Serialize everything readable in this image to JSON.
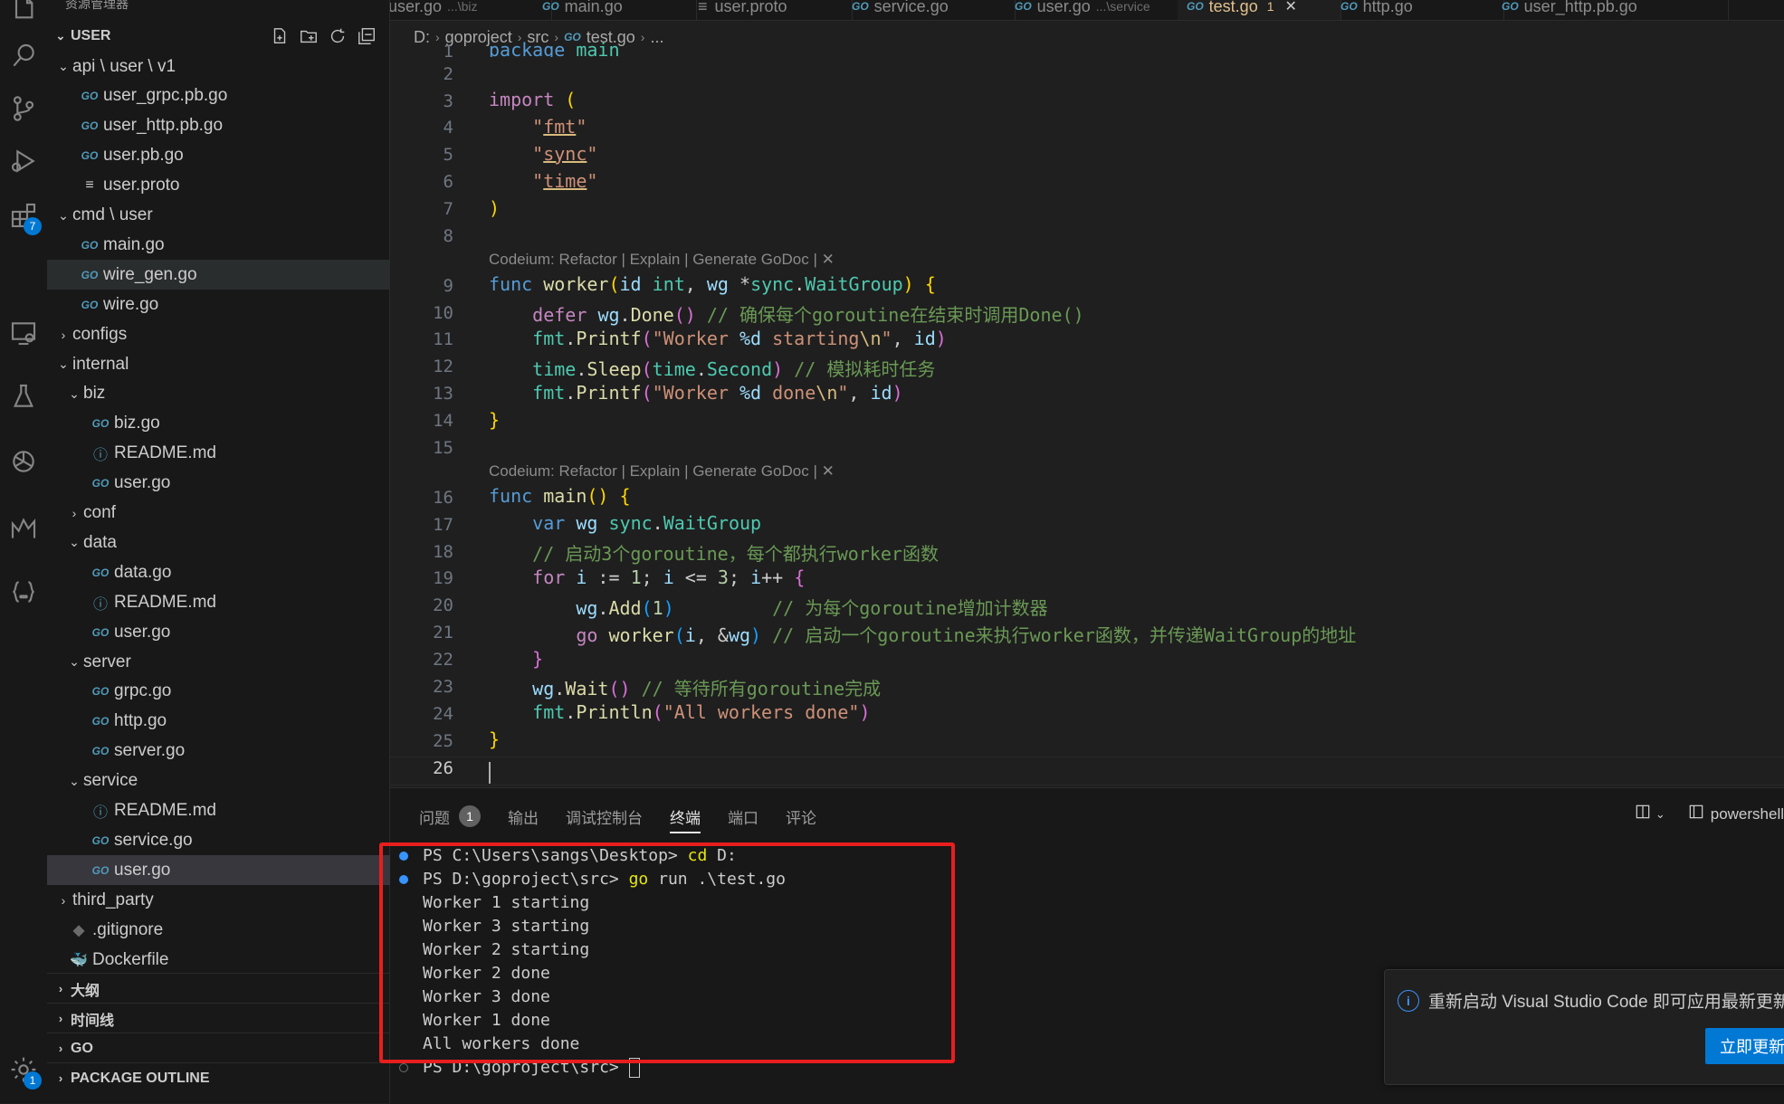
{
  "sidebar": {
    "title": "资源管理器",
    "section_user": "USER",
    "tree": [
      {
        "label": "api \\ user \\ v1",
        "type": "folder-open",
        "indent": 1
      },
      {
        "label": "user_grpc.pb.go",
        "type": "go",
        "indent": 2
      },
      {
        "label": "user_http.pb.go",
        "type": "go",
        "indent": 2
      },
      {
        "label": "user.pb.go",
        "type": "go",
        "indent": 2
      },
      {
        "label": "user.proto",
        "type": "proto",
        "indent": 2
      },
      {
        "label": "cmd \\ user",
        "type": "folder-open",
        "indent": 1
      },
      {
        "label": "main.go",
        "type": "go",
        "indent": 2
      },
      {
        "label": "wire_gen.go",
        "type": "go",
        "indent": 2
      },
      {
        "label": "wire.go",
        "type": "go",
        "indent": 2
      },
      {
        "label": "configs",
        "type": "folder-closed",
        "indent": 1
      },
      {
        "label": "internal",
        "type": "folder-open",
        "indent": 1
      },
      {
        "label": "biz",
        "type": "folder-open",
        "indent": 2
      },
      {
        "label": "biz.go",
        "type": "go",
        "indent": 3
      },
      {
        "label": "README.md",
        "type": "info",
        "indent": 3
      },
      {
        "label": "user.go",
        "type": "go",
        "indent": 3
      },
      {
        "label": "conf",
        "type": "folder-closed",
        "indent": 2
      },
      {
        "label": "data",
        "type": "folder-open",
        "indent": 2
      },
      {
        "label": "data.go",
        "type": "go",
        "indent": 3
      },
      {
        "label": "README.md",
        "type": "info",
        "indent": 3
      },
      {
        "label": "user.go",
        "type": "go",
        "indent": 3
      },
      {
        "label": "server",
        "type": "folder-open",
        "indent": 2
      },
      {
        "label": "grpc.go",
        "type": "go",
        "indent": 3
      },
      {
        "label": "http.go",
        "type": "go",
        "indent": 3
      },
      {
        "label": "server.go",
        "type": "go",
        "indent": 3
      },
      {
        "label": "service",
        "type": "folder-open",
        "indent": 2
      },
      {
        "label": "README.md",
        "type": "info",
        "indent": 3
      },
      {
        "label": "service.go",
        "type": "go",
        "indent": 3
      },
      {
        "label": "user.go",
        "type": "go",
        "indent": 3
      },
      {
        "label": "third_party",
        "type": "folder-closed",
        "indent": 1
      },
      {
        "label": ".gitignore",
        "type": "git",
        "indent": 1
      },
      {
        "label": "Dockerfile",
        "type": "docker",
        "indent": 1
      }
    ],
    "bottom_sections": [
      "大纲",
      "时间线",
      "GO",
      "PACKAGE OUTLINE"
    ]
  },
  "activity": {
    "extensions_badge": "7",
    "settings_badge": "1"
  },
  "tabs": [
    {
      "label": "user.go",
      "sub": "...\\biz"
    },
    {
      "label": "main.go",
      "sub": ""
    },
    {
      "label": "user.proto",
      "sub": ""
    },
    {
      "label": "service.go",
      "sub": ""
    },
    {
      "label": "user.go",
      "sub": "...\\service"
    },
    {
      "label": "test.go",
      "sub": "",
      "active": true,
      "modified": "1"
    },
    {
      "label": "http.go",
      "sub": ""
    },
    {
      "label": "user_http.pb.go",
      "sub": ""
    }
  ],
  "breadcrumb": [
    "D:",
    "goproject",
    "src",
    "test.go",
    "..."
  ],
  "code_lens": "Codeium: Refactor | Explain | Generate GoDoc | ✕",
  "line_numbers": [
    "1",
    "2",
    "3",
    "4",
    "5",
    "6",
    "7",
    "8",
    "9",
    "10",
    "11",
    "12",
    "13",
    "14",
    "15",
    "16",
    "17",
    "18",
    "19",
    "20",
    "21",
    "22",
    "23",
    "24",
    "25",
    "26"
  ],
  "panel": {
    "tabs": [
      "问题",
      "输出",
      "调试控制台",
      "终端",
      "端口",
      "评论"
    ],
    "problems_count": "1",
    "terminal_name": "powershell",
    "terminal_lines": [
      "PS C:\\Users\\sangs\\Desktop> cd D:",
      "PS D:\\goproject\\src> go run .\\test.go",
      "Worker 1 starting",
      "Worker 3 starting",
      "Worker 2 starting",
      "Worker 2 done",
      "Worker 3 done",
      "Worker 1 done",
      "All workers done",
      "PS D:\\goproject\\src> "
    ]
  },
  "notification": {
    "message": "重新启动 Visual Studio Code 即可应用最新更新",
    "button": "立即更新"
  },
  "colors": {
    "accent": "#0078d4",
    "highlight_box": "#e81e1e"
  }
}
